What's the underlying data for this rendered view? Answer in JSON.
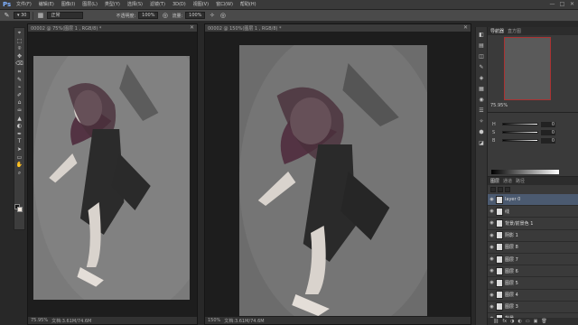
{
  "app": {
    "logo": "Ps"
  },
  "menu": [
    "文件(F)",
    "编辑(E)",
    "图像(I)",
    "图层(L)",
    "类型(Y)",
    "选择(S)",
    "滤镜(T)",
    "3D(D)",
    "视图(V)",
    "窗口(W)",
    "帮助(H)"
  ],
  "window_controls": [
    "—",
    "□",
    "✕"
  ],
  "options": {
    "mode_value": "正常",
    "opacity_label": "不透明度:",
    "opacity_value": "100%",
    "flow_label": "流量:",
    "flow_value": "100%"
  },
  "tools": [
    "⌖",
    "⬚",
    "⌾",
    "✥",
    "⌫",
    "⌗",
    "✎",
    "⌁",
    "✐",
    "⌂",
    "♒",
    "▲",
    "◐",
    "✒",
    "T",
    "➤",
    "▭",
    "✋",
    "⌕"
  ],
  "doc_left": {
    "title": "00002 @ 75%(图层 1 , RGB/8) *",
    "status_zoom": "75.95%",
    "status_info": "文档:3.61M/74.6M"
  },
  "doc_right": {
    "title": "00002 @ 150%(图层 1 , RGB/8) *",
    "status_zoom": "150%",
    "status_info": "文档:3.61M/74.6M"
  },
  "dock_icons": [
    "◧",
    "▤",
    "◫",
    "✎",
    "◈",
    "▦",
    "◉",
    "☰",
    "✧",
    "⬢",
    "◪"
  ],
  "navigator": {
    "tabs": [
      "导航器",
      "直方图"
    ],
    "zoom": "75.95%"
  },
  "adjust": {
    "sliders": [
      {
        "label": "H",
        "value": "0"
      },
      {
        "label": "S",
        "value": "0"
      },
      {
        "label": "B",
        "value": "0"
      }
    ]
  },
  "layers_panel": {
    "tabs": [
      "图层",
      "通道",
      "路径"
    ],
    "rows": [
      {
        "name": "layer 0"
      },
      {
        "name": "线"
      },
      {
        "name": "背景/前景色 1"
      },
      {
        "name": "阴影 1"
      },
      {
        "name": "图层 8"
      },
      {
        "name": "图层 7"
      },
      {
        "name": "图层 6"
      },
      {
        "name": "图层 5"
      },
      {
        "name": "图层 4"
      },
      {
        "name": "图层 3"
      },
      {
        "name": "背景"
      }
    ],
    "footer_icons": [
      "⛓",
      "fx",
      "◑",
      "◐",
      "▭",
      "▣",
      "🗑"
    ]
  },
  "colors": {
    "fg": "#151515",
    "bg": "#efe7dd",
    "accent": "#4b5a70"
  }
}
